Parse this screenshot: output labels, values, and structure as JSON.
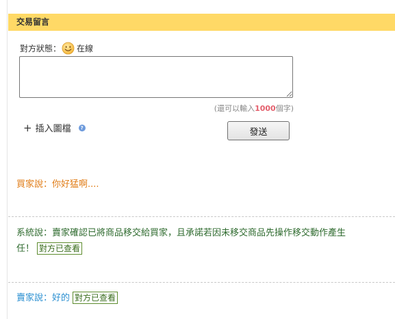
{
  "header": {
    "title": "交易留言"
  },
  "status": {
    "label": "對方狀態：",
    "state": "在線"
  },
  "message_input": {
    "value": "",
    "counter_prefix": "(還可以輸入",
    "counter_value": "1000",
    "counter_suffix": "個字)"
  },
  "insert_image": {
    "plus": "+",
    "label": "插入圖檔",
    "help_glyph": "?"
  },
  "send_button": {
    "label": "發送"
  },
  "messages": [
    {
      "speaker": "買家說：",
      "text": "你好猛啊....",
      "badge": ""
    },
    {
      "speaker": "系統說：",
      "text": "賣家確認已將商品移交給買家，且承諾若因未移交商品先操作移交動作產生",
      "text_line2": "任！",
      "badge": "對方已查看"
    },
    {
      "speaker": "賣家說：",
      "text": "好的",
      "badge": "對方已查看"
    }
  ],
  "colors": {
    "header_bg": "#ffd966",
    "buyer_text": "#e07b14",
    "system_text": "#2f6b2f",
    "seller_text": "#2a8fd1",
    "counter_number": "#e4606d"
  },
  "icons": {
    "status": "smiley-face-icon",
    "help": "help-circle-icon"
  }
}
